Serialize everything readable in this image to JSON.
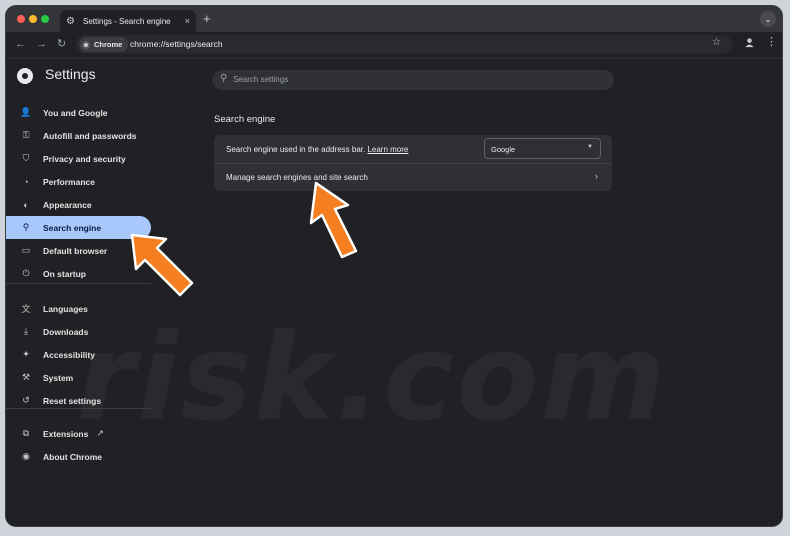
{
  "window": {
    "tab_title": "Settings - Search engine",
    "tab_close": "×",
    "new_tab": "+",
    "tab_menu": "⌄"
  },
  "toolbar": {
    "back": "←",
    "forward": "→",
    "reload": "↻",
    "chip_label": "Chrome",
    "url": "chrome://settings/search",
    "star": "☆",
    "menu": "⋮"
  },
  "header": {
    "title": "Settings",
    "search_placeholder": "Search settings"
  },
  "sidebar": {
    "items": [
      {
        "label": "You and Google",
        "icon": "person-icon",
        "glyph": "👤"
      },
      {
        "label": "Autofill and passwords",
        "icon": "key-icon",
        "glyph": "⚿"
      },
      {
        "label": "Privacy and security",
        "icon": "shield-icon",
        "glyph": "⛉"
      },
      {
        "label": "Performance",
        "icon": "speedometer-icon",
        "glyph": "◔"
      },
      {
        "label": "Appearance",
        "icon": "palette-icon",
        "glyph": "◐"
      },
      {
        "label": "Search engine",
        "icon": "search-icon",
        "glyph": "⚲"
      },
      {
        "label": "Default browser",
        "icon": "browser-icon",
        "glyph": "▭"
      },
      {
        "label": "On startup",
        "icon": "power-icon",
        "glyph": "⏻"
      },
      {
        "label": "Languages",
        "icon": "translate-icon",
        "glyph": "文"
      },
      {
        "label": "Downloads",
        "icon": "download-icon",
        "glyph": "⤓"
      },
      {
        "label": "Accessibility",
        "icon": "accessibility-icon",
        "glyph": "✦"
      },
      {
        "label": "System",
        "icon": "wrench-icon",
        "glyph": "⚒"
      },
      {
        "label": "Reset settings",
        "icon": "reset-icon",
        "glyph": "↺"
      },
      {
        "label": "Extensions",
        "icon": "puzzle-icon",
        "glyph": "⧉"
      },
      {
        "label": "About Chrome",
        "icon": "chrome-icon",
        "glyph": "◉"
      }
    ],
    "active_index": 5,
    "external_link_glyph": "↗"
  },
  "main": {
    "section_title": "Search engine",
    "address_bar_text": "Search engine used in the address bar.",
    "learn_more": "Learn more",
    "selected_engine": "Google",
    "manage_label": "Manage search engines and site search",
    "chevron": "›"
  },
  "watermark": "risk.com",
  "colors": {
    "accent": "#a8c7fa",
    "arrow": "#f57f20",
    "background": "#202124"
  }
}
